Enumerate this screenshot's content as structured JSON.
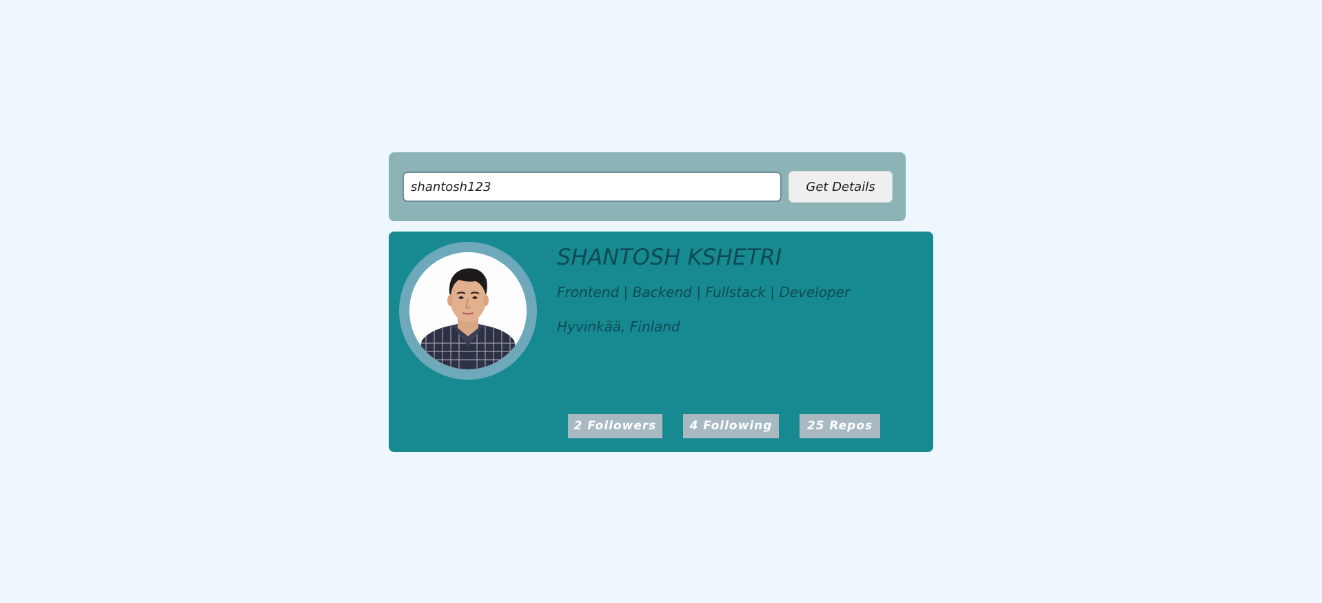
{
  "search": {
    "value": "shantosh123",
    "button_label": "Get Details"
  },
  "profile": {
    "name": "SHANTOSH KSHETRI",
    "bio": "Frontend | Backend | Fullstack | Developer",
    "location": "Hyvinkää, Finland",
    "avatar_icon": "user-photo-icon"
  },
  "stats": {
    "followers": "2 Followers",
    "following": "4 Following",
    "repos": "25 Repos"
  },
  "colors": {
    "page_background": "#eef7fe",
    "search_panel": "#8cb4b6",
    "profile_card": "#178a91",
    "avatar_ring": "#6ea9bb",
    "stat_badge": "#a9b9c1",
    "text_dark_teal": "#0d4a54"
  }
}
